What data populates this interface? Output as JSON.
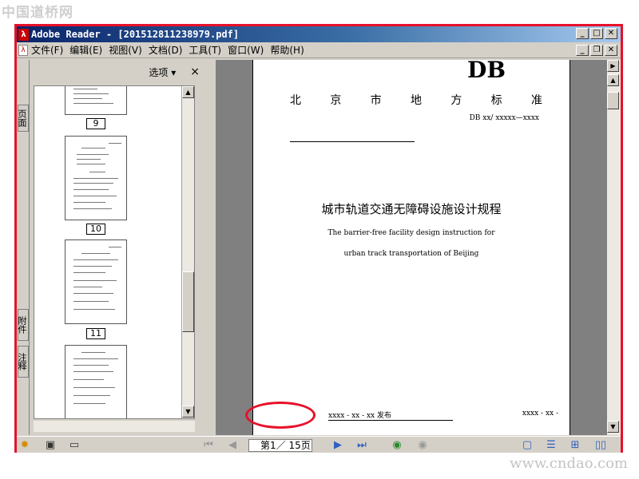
{
  "watermarks": {
    "top_left": "中国道桥网",
    "bottom_right": "www.cndao.com"
  },
  "window": {
    "title": "Adobe Reader - [201512811238979.pdf]",
    "app_icon": "adobe-reader-icon"
  },
  "menu": {
    "items": [
      "文件(F)",
      "编辑(E)",
      "视图(V)",
      "文档(D)",
      "工具(T)",
      "窗口(W)",
      "帮助(H)"
    ]
  },
  "side_tabs": {
    "pages": "页面",
    "attachments": "附件",
    "comments": "注释"
  },
  "nav_pane": {
    "options_label": "选项 ▾",
    "close_label": "×",
    "thumbnails": [
      {
        "label": "9"
      },
      {
        "label": "10"
      },
      {
        "label": "11"
      }
    ]
  },
  "page": {
    "standard_mark": "DB",
    "org_chars": [
      "北",
      "京",
      "市",
      "地",
      "方",
      "标",
      "准"
    ],
    "code": "DB xx/ xxxxx—xxxx",
    "title_cn": "城市轨道交通无障碍设施设计规程",
    "title_en_line1": "The barrier-free facility design instruction for",
    "title_en_line2": "urban track transportation of Beijing",
    "publish": "xxxx - xx - xx 发布",
    "implement": "xxxx - xx -"
  },
  "statusbar": {
    "page_indicator": "第1／ 15页"
  },
  "colors": {
    "highlight": "#e8102a",
    "title_start": "#0a246a",
    "title_end": "#a6caf0"
  }
}
